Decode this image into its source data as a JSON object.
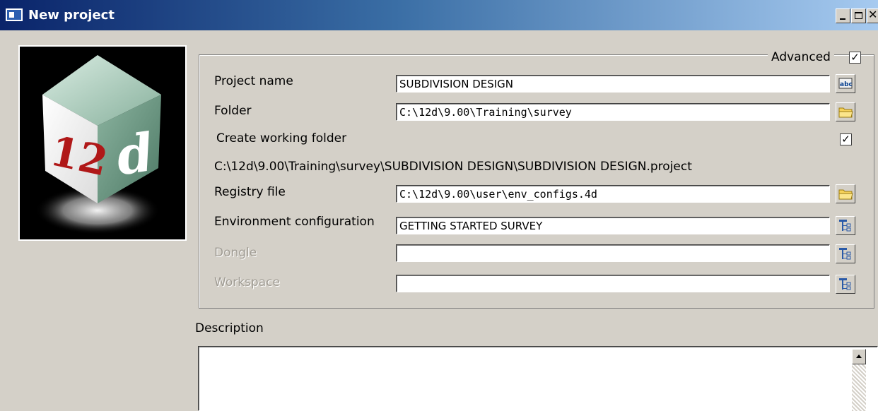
{
  "window": {
    "title": "New project",
    "controls": [
      "minimize",
      "maximize",
      "close"
    ],
    "close_glyph": "✕"
  },
  "logo": {
    "text_left": "12",
    "text_right": "d"
  },
  "advanced": {
    "label": "Advanced",
    "checked": true,
    "check_glyph": "✓"
  },
  "form": {
    "project_name": {
      "label": "Project name",
      "value": "SUBDIVISION DESIGN",
      "button_icon": "abc-icon"
    },
    "folder": {
      "label": "Folder",
      "value": "C:\\12d\\9.00\\Training\\survey",
      "button_icon": "folder-icon"
    },
    "create_working_folder": {
      "label": "Create working folder",
      "checked": true,
      "check_glyph": "✓"
    },
    "project_path": "C:\\12d\\9.00\\Training\\survey\\SUBDIVISION DESIGN\\SUBDIVISION DESIGN.project",
    "registry_file": {
      "label": "Registry file",
      "value": "C:\\12d\\9.00\\user\\env_configs.4d",
      "button_icon": "folder-icon"
    },
    "environment_configuration": {
      "label": "Environment configuration",
      "value": "GETTING STARTED SURVEY",
      "button_icon": "tree-select-icon"
    },
    "dongle": {
      "label": "Dongle",
      "value": "",
      "disabled": true,
      "button_icon": "tree-select-icon"
    },
    "workspace": {
      "label": "Workspace",
      "value": "",
      "disabled": true,
      "button_icon": "tree-select-icon"
    }
  },
  "description": {
    "label": "Description",
    "value": ""
  },
  "colors": {
    "titlebar_start": "#0a246a",
    "titlebar_end": "#a6caf0",
    "dialog_bg": "#d4d0c8",
    "logo_cube_left": "#ffffff",
    "logo_cube_right": "#6f9a86",
    "logo_cube_top": "#b8d6c6",
    "logo_text": "#b01818"
  }
}
